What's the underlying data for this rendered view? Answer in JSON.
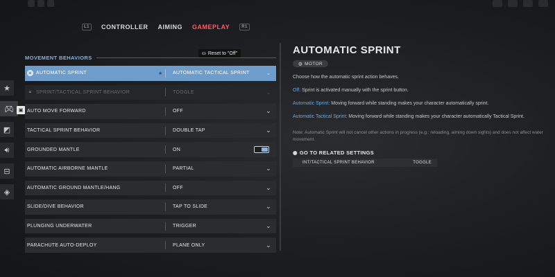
{
  "tabs": [
    {
      "key": "L1",
      "label": "CONTROLLER",
      "active": false
    },
    {
      "key": "",
      "label": "AIMING",
      "active": false
    },
    {
      "key": "R1",
      "label": "GAMEPLAY",
      "active": true
    }
  ],
  "section": {
    "title": "MOVEMENT BEHAVIORS",
    "reset_tooltip": "Reset to \"Off\""
  },
  "rows": [
    {
      "label": "AUTOMATIC SPRINT",
      "value": "AUTOMATIC TACTICAL SPRINT",
      "state": "selected"
    },
    {
      "label": "SPRINT/TACTICAL SPRINT BEHAVIOR",
      "value": "TOGGLE",
      "state": "locked"
    },
    {
      "label": "AUTO MOVE FORWARD",
      "value": "OFF",
      "state": "normal"
    },
    {
      "label": "TACTICAL SPRINT BEHAVIOR",
      "value": "DOUBLE TAP",
      "state": "normal"
    },
    {
      "label": "GROUNDED MANTLE",
      "value": "ON",
      "state": "toggle"
    },
    {
      "label": "AUTOMATIC AIRBORNE MANTLE",
      "value": "PARTIAL",
      "state": "normal"
    },
    {
      "label": "AUTOMATIC GROUND MANTLE/HANG",
      "value": "OFF",
      "state": "normal"
    },
    {
      "label": "SLIDE/DIVE BEHAVIOR",
      "value": "TAP TO SLIDE",
      "state": "normal"
    },
    {
      "label": "PLUNGING UNDERWATER",
      "value": "TRIGGER",
      "state": "normal"
    },
    {
      "label": "PARACHUTE AUTO-DEPLOY",
      "value": "PLANE ONLY",
      "state": "normal"
    }
  ],
  "rail_icons": [
    "star-icon",
    "controller-icon",
    "display-icon",
    "speaker-icon",
    "interface-icon",
    "network-icon"
  ],
  "detail": {
    "title": "AUTOMATIC SPRINT",
    "tag": "MOTOR",
    "intro": "Choose how the automatic sprint action behaves.",
    "options": [
      {
        "name": "Off:",
        "text": " Sprint is activated manually with the sprint button."
      },
      {
        "name": "Automatic Sprint:",
        "text": " Moving forward while standing makes your character automatically sprint."
      },
      {
        "name": "Automatic Tactical Sprint:",
        "text": " Moving forward while standing makes your character automatically Tactical Sprint."
      }
    ],
    "note": "Note: Automatic Sprint will not cancel other actions in progress (e.g.: reloading, aiming down sights) and does not affect water movement.",
    "related_title": "GO TO RELATED SETTINGS",
    "related": [
      {
        "label": "INT/TACTICAL SPRINT BEHAVIOR",
        "value": "TOGGLE"
      }
    ]
  },
  "colors": {
    "accent_blue": "#6e9ccb",
    "section_blue": "#7fb5e6",
    "active_tab_red": "#ff5a64",
    "highlight_blue": "#6ea8e0"
  }
}
